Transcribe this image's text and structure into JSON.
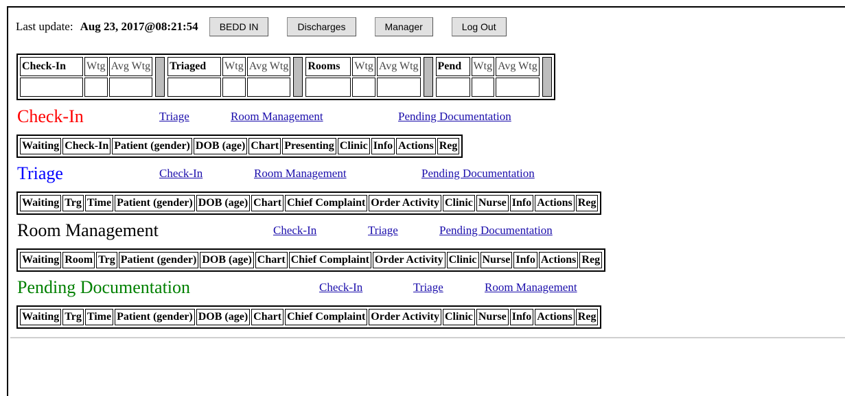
{
  "header": {
    "last_update_label": "Last update:",
    "last_update_value": "Aug 23, 2017@08:21:54",
    "buttons": [
      "BEDD IN",
      "Discharges",
      "Manager",
      "Log Out"
    ]
  },
  "summary": [
    {
      "label": "Check-In",
      "wtg": "Wtg",
      "avg": "Avg Wtg"
    },
    {
      "label": "Triaged",
      "wtg": "Wtg",
      "avg": "Avg Wtg"
    },
    {
      "label": "Rooms",
      "wtg": "Wtg",
      "avg": "Avg Wtg"
    },
    {
      "label": "Pend",
      "wtg": "Wtg",
      "avg": "Avg Wtg"
    }
  ],
  "sections": [
    {
      "title": "Check-In",
      "color": "#ff0000",
      "links": [
        "Triage",
        "Room Management",
        "Pending Documentation"
      ],
      "columns": [
        "Waiting",
        "Check-In",
        "Patient (gender)",
        "DOB (age)",
        "Chart",
        "Presenting",
        "Clinic",
        "Info",
        "Actions",
        "Reg"
      ]
    },
    {
      "title": "Triage",
      "color": "#0000ff",
      "links": [
        "Check-In",
        "Room Management",
        "Pending Documentation"
      ],
      "columns": [
        "Waiting",
        "Trg",
        "Time",
        "Patient (gender)",
        "DOB (age)",
        "Chart",
        "Chief Complaint",
        "Order Activity",
        "Clinic",
        "Nurse",
        "Info",
        "Actions",
        "Reg"
      ]
    },
    {
      "title": "Room Management",
      "color": "#000000",
      "links": [
        "Check-In",
        "Triage",
        "Pending Documentation"
      ],
      "columns": [
        "Waiting",
        "Room",
        "Trg",
        "Patient (gender)",
        "DOB (age)",
        "Chart",
        "Chief Complaint",
        "Order Activity",
        "Clinic",
        "Nurse",
        "Info",
        "Actions",
        "Reg"
      ]
    },
    {
      "title": "Pending Documentation",
      "color": "#008000",
      "links": [
        "Check-In",
        "Triage",
        "Room Management"
      ],
      "columns": [
        "Waiting",
        "Trg",
        "Time",
        "Patient (gender)",
        "DOB (age)",
        "Chart",
        "Chief Complaint",
        "Order Activity",
        "Clinic",
        "Nurse",
        "Info",
        "Actions",
        "Reg"
      ]
    }
  ]
}
